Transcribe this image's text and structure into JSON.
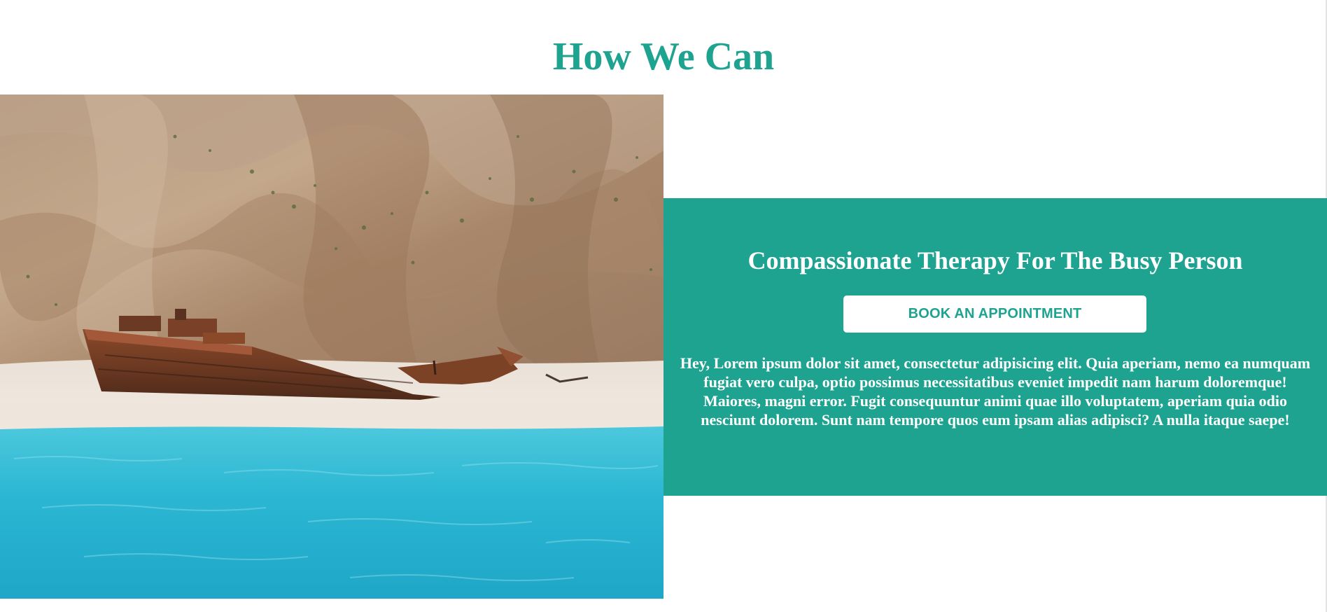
{
  "colors": {
    "accent": "#1ea391",
    "background": "#ffffff",
    "panel_text": "#ffffff"
  },
  "section": {
    "title": "How We Can"
  },
  "hero_image": {
    "description": "beach-with-shipwreck-photo"
  },
  "info_panel": {
    "title": "Compassionate Therapy For The Busy Person",
    "button_label": "BOOK AN APPOINTMENT",
    "body": "Hey, Lorem ipsum dolor sit amet, consectetur adipisicing elit. Quia aperiam, nemo ea numquam fugiat vero culpa, optio possimus necessitatibus eveniet impedit nam harum doloremque! Maiores, magni error. Fugit consequuntur animi quae illo voluptatem, aperiam quia odio nesciunt dolorem. Sunt nam tempore quos eum ipsam alias adipisci? A nulla itaque saepe!"
  }
}
